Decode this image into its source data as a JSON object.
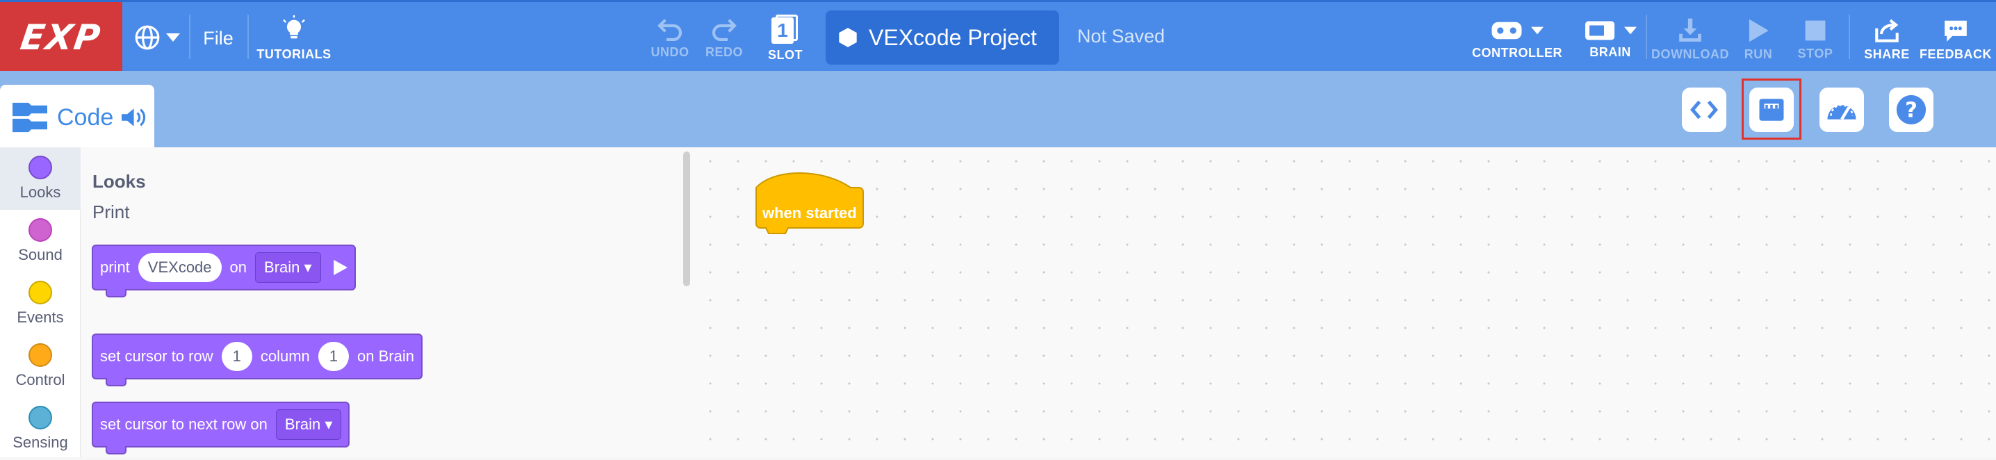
{
  "app": {
    "logo": "EXP",
    "file_label": "File",
    "tutorials_label": "TUTORIALS",
    "undo_label": "UNDO",
    "redo_label": "REDO",
    "slot_label": "SLOT",
    "slot_number": "1",
    "project_name": "VEXcode Project",
    "save_status": "Not Saved",
    "controller_label": "CONTROLLER",
    "brain_label": "BRAIN",
    "download_label": "DOWNLOAD",
    "run_label": "RUN",
    "stop_label": "STOP",
    "share_label": "SHARE",
    "feedback_label": "FEEDBACK"
  },
  "tabs": {
    "code_label": "Code"
  },
  "categories": [
    {
      "label": "Looks",
      "color": "#9966ff",
      "active": true
    },
    {
      "label": "Sound",
      "color": "#cf63cf",
      "active": false
    },
    {
      "label": "Events",
      "color": "#ffd500",
      "active": false
    },
    {
      "label": "Control",
      "color": "#ffab19",
      "active": false
    },
    {
      "label": "Sensing",
      "color": "#5cb1d6",
      "active": false
    }
  ],
  "palette": {
    "section_title": "Looks",
    "subsection": "Print",
    "block_print": {
      "text1": "print",
      "value": "VEXcode",
      "text2": "on",
      "dropdown": "Brain"
    },
    "block_set_cursor": {
      "text1": "set cursor to row",
      "row": "1",
      "text2": "column",
      "column": "1",
      "text3": "on Brain"
    },
    "block_next_row": {
      "text1": "set cursor to next row on",
      "dropdown": "Brain"
    }
  },
  "workspace": {
    "hat_block_label": "when started"
  },
  "colors": {
    "topbar": "#4a8ae8",
    "logo_bg": "#d3393b",
    "looks": "#9966ff",
    "events": "#ffbf00"
  }
}
